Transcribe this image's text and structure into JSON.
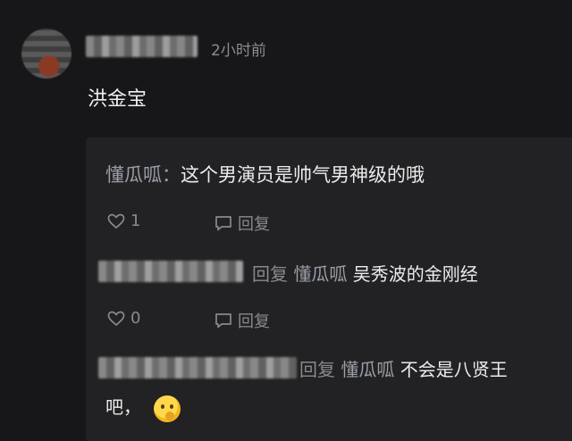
{
  "comment": {
    "time": "2小时前",
    "text": "洪金宝"
  },
  "replies": [
    {
      "author": "懂瓜呱",
      "separator": "：",
      "text": "这个男演员是帅气男神级的哦",
      "likes": "1",
      "reply_label": "回复"
    },
    {
      "reply_label": "回复",
      "reply_to": "懂瓜呱",
      "text": "吴秀波的金刚经",
      "likes": "0",
      "action_reply_label": "回复"
    },
    {
      "reply_label": "回复",
      "reply_to": "懂瓜呱",
      "text_line1": "不会是八贤王",
      "text_line2": "吧，"
    }
  ],
  "icons": {
    "like": "heart-icon",
    "reply": "comment-icon",
    "emoji": "hand-over-mouth-emoji"
  },
  "colors": {
    "background": "#171719",
    "reply_box": "#222224",
    "author": "#9b9fa8",
    "muted": "#8a8a8a"
  }
}
